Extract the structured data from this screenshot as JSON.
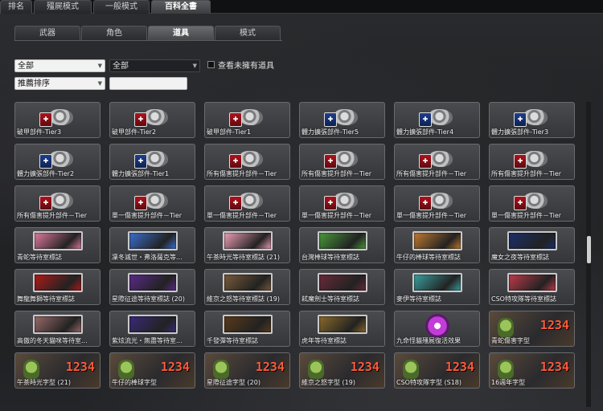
{
  "top_tabs": [
    "排名",
    "殭屍模式",
    "一般模式",
    "百科全書"
  ],
  "active_top_tab": 3,
  "sub_tabs": [
    "武器",
    "角色",
    "道具",
    "模式"
  ],
  "active_sub_tab": 2,
  "filters": {
    "category": "全部",
    "subcategory": "全部",
    "sort": "推薦排序",
    "search_value": "",
    "show_unowned_label": "查看未擁有道具"
  },
  "rows": [
    [
      {
        "type": "part",
        "badge": "red",
        "name": "破甲部件-Tier3"
      },
      {
        "type": "part",
        "badge": "red",
        "name": "破甲部件-Tier2"
      },
      {
        "type": "part",
        "badge": "red",
        "name": "破甲部件-Tier1"
      },
      {
        "type": "part",
        "badge": "blue",
        "name": "體力擴張部件-Tier5"
      },
      {
        "type": "part",
        "badge": "blue",
        "name": "體力擴張部件-Tier4"
      },
      {
        "type": "part",
        "badge": "blue",
        "name": "體力擴張部件-Tier3"
      }
    ],
    [
      {
        "type": "part",
        "badge": "blue",
        "name": "體力擴張部件-Tier2"
      },
      {
        "type": "part",
        "badge": "blue",
        "name": "體力擴張部件-Tier1"
      },
      {
        "type": "part",
        "badge": "red",
        "name": "所有傷害提升部件－Tier"
      },
      {
        "type": "part",
        "badge": "red",
        "name": "所有傷害提升部件－Tier"
      },
      {
        "type": "part",
        "badge": "red",
        "name": "所有傷害提升部件－Tier"
      },
      {
        "type": "part",
        "badge": "red",
        "name": "所有傷害提升部件－Tier"
      }
    ],
    [
      {
        "type": "part",
        "badge": "red",
        "name": "所有傷害提升部件－Tier"
      },
      {
        "type": "part",
        "badge": "red",
        "name": "單一傷害提升部件－Tier"
      },
      {
        "type": "part",
        "badge": "red",
        "name": "單一傷害提升部件－Tier"
      },
      {
        "type": "part",
        "badge": "red",
        "name": "單一傷害提升部件－Tier"
      },
      {
        "type": "part",
        "badge": "red",
        "name": "單一傷害提升部件－Tier"
      },
      {
        "type": "part",
        "badge": "red",
        "name": "單一傷害提升部件－Tier"
      }
    ],
    [
      {
        "type": "emblem",
        "color": "#e07aa0",
        "name": "青蛇等待室標誌"
      },
      {
        "type": "emblem",
        "color": "#3a6fd1",
        "name": "凜冬滅世・弗洛薩克等..."
      },
      {
        "type": "emblem",
        "color": "#f0a0b8",
        "name": "午茶時光等待室標誌 (21)"
      },
      {
        "type": "emblem",
        "color": "#4a9a3a",
        "name": "台灣棒球等待室標誌"
      },
      {
        "type": "emblem",
        "color": "#c07a30",
        "name": "牛仔的棒球等待室標誌"
      },
      {
        "type": "emblem",
        "color": "#1a2f6a",
        "name": "魔女之夜等待室標誌"
      }
    ],
    [
      {
        "type": "emblem",
        "color": "#b01a1a",
        "name": "舞龍舞獅等待室標誌"
      },
      {
        "type": "emblem",
        "color": "#5a2a8a",
        "name": "星際征途等待室標誌 (20)"
      },
      {
        "type": "emblem",
        "color": "#7a5a3a",
        "name": "維京之怒等待室標誌 (19)"
      },
      {
        "type": "emblem",
        "color": "#6a2a3a",
        "name": "弒魔劍士等待室標誌"
      },
      {
        "type": "emblem",
        "color": "#3aa0a0",
        "name": "麥伊等待室標誌"
      },
      {
        "type": "emblem",
        "color": "#c03a4a",
        "name": "CSO特攻隊等待室標誌"
      }
    ],
    [
      {
        "type": "emblem",
        "color": "#9a6a6a",
        "name": "高傲的冬天貓咪等待室..."
      },
      {
        "type": "emblem",
        "color": "#3a2a7a",
        "name": "紫炫流光・無盡等待室..."
      },
      {
        "type": "emblem",
        "color": "#5a3a1a",
        "name": "千發彈等待室標誌"
      },
      {
        "type": "emblem",
        "color": "#8a6a2a",
        "name": "虎年等待室標誌"
      },
      {
        "type": "spray",
        "name": "九命怪貓殭屍復活效果"
      },
      {
        "type": "font",
        "name": "青蛇傷害字型"
      }
    ],
    [
      {
        "type": "font",
        "name": "午茶時光字型 (21)"
      },
      {
        "type": "font",
        "name": "牛仔的棒球字型"
      },
      {
        "type": "font",
        "name": "星際征途字型 (20)"
      },
      {
        "type": "font",
        "name": "維京之怒字型 (19)"
      },
      {
        "type": "font",
        "name": "CSO特攻隊字型 (S18)"
      },
      {
        "type": "font",
        "name": "16週年字型"
      }
    ]
  ],
  "font_sample": "1234"
}
